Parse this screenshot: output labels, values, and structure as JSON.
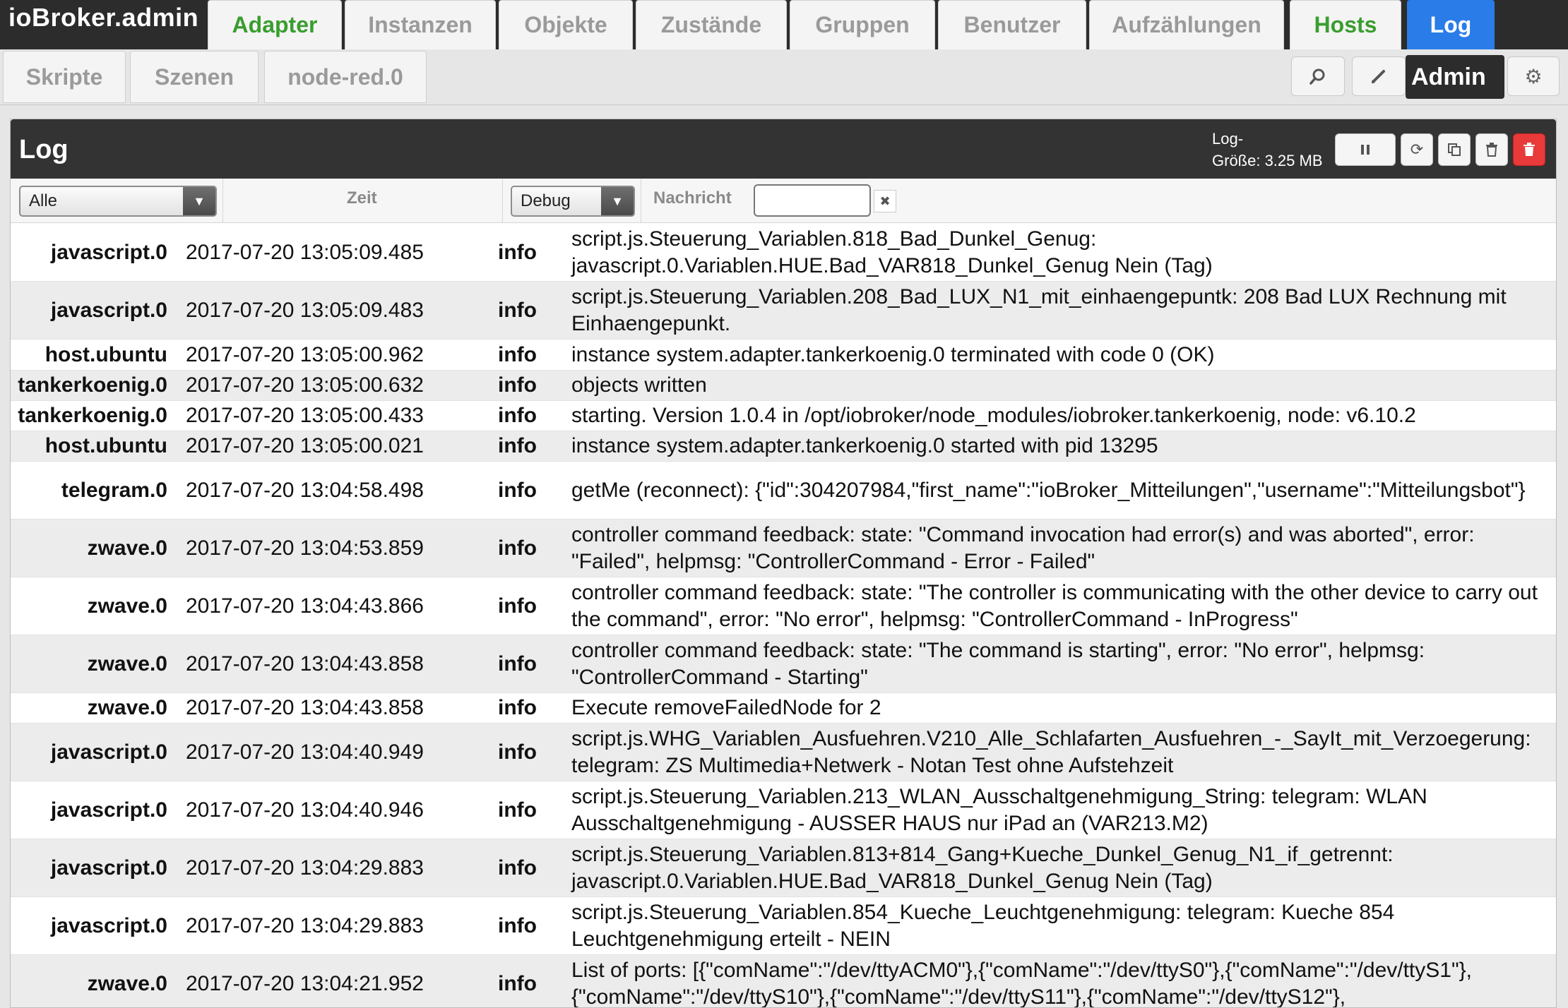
{
  "app": {
    "brand": "ioBroker.admin"
  },
  "tabs": [
    {
      "label": "Adapter"
    },
    {
      "label": "Instanzen"
    },
    {
      "label": "Objekte"
    },
    {
      "label": "Zustände"
    },
    {
      "label": "Gruppen"
    },
    {
      "label": "Benutzer"
    },
    {
      "label": "Aufzählungen"
    },
    {
      "label": "Hosts"
    },
    {
      "label": "Log"
    }
  ],
  "subtabs": [
    {
      "label": "Skripte"
    },
    {
      "label": "Szenen"
    },
    {
      "label": "node-red.0"
    }
  ],
  "user": {
    "name": "Admin"
  },
  "panel": {
    "title": "Log",
    "log_size_label": "Log-",
    "log_size_value": "Größe: 3.25 MB"
  },
  "filters": {
    "source_selected": "Alle",
    "time_header": "Zeit",
    "level_selected": "Debug",
    "message_header": "Nachricht",
    "message_value": ""
  },
  "icons": {
    "search": "search-icon",
    "edit": "pencil-icon",
    "settings": "gear-icon",
    "pause": "pause-icon",
    "refresh": "refresh-icon",
    "copy": "copy-icon",
    "trash": "trash-icon",
    "clear": "close-icon"
  },
  "colors": {
    "accent": "#2a7ce8",
    "green": "#3a9d2f",
    "danger": "#e83a3a"
  },
  "log": [
    {
      "source": "javascript.0",
      "time": "2017-07-20 13:05:09.485",
      "severity": "info",
      "message": "script.js.Steuerung_Variablen.818_Bad_Dunkel_Genug: javascript.0.Variablen.HUE.Bad_VAR818_Dunkel_Genug Nein (Tag)"
    },
    {
      "source": "javascript.0",
      "time": "2017-07-20 13:05:09.483",
      "severity": "info",
      "message": "script.js.Steuerung_Variablen.208_Bad_LUX_N1_mit_einhaengepuntk: 208 Bad LUX Rechnung mit Einhaengepunkt."
    },
    {
      "source": "host.ubuntu",
      "time": "2017-07-20 13:05:00.962",
      "severity": "info",
      "message": "instance system.adapter.tankerkoenig.0 terminated with code 0 (OK)"
    },
    {
      "source": "tankerkoenig.0",
      "time": "2017-07-20 13:05:00.632",
      "severity": "info",
      "message": "objects written"
    },
    {
      "source": "tankerkoenig.0",
      "time": "2017-07-20 13:05:00.433",
      "severity": "info",
      "message": "starting. Version 1.0.4 in /opt/iobroker/node_modules/iobroker.tankerkoenig, node: v6.10.2"
    },
    {
      "source": "host.ubuntu",
      "time": "2017-07-20 13:05:00.021",
      "severity": "info",
      "message": "instance system.adapter.tankerkoenig.0 started with pid 13295"
    },
    {
      "source": "telegram.0",
      "time": "2017-07-20 13:04:58.498",
      "severity": "info",
      "message": "getMe (reconnect): {\"id\":304207984,\"first_name\":\"ioBroker_Mitteilungen\",\"username\":\"Mitteilungsbot\"}"
    },
    {
      "source": "zwave.0",
      "time": "2017-07-20 13:04:53.859",
      "severity": "info",
      "message": "controller command feedback: state: \"Command invocation had error(s) and was aborted\", error: \"Failed\", helpmsg: \"ControllerCommand - Error - Failed\""
    },
    {
      "source": "zwave.0",
      "time": "2017-07-20 13:04:43.866",
      "severity": "info",
      "message": "controller command feedback: state: \"The controller is communicating with the other device to carry out the command\", error: \"No error\", helpmsg: \"ControllerCommand - InProgress\""
    },
    {
      "source": "zwave.0",
      "time": "2017-07-20 13:04:43.858",
      "severity": "info",
      "message": "controller command feedback: state: \"The command is starting\", error: \"No error\", helpmsg: \"ControllerCommand - Starting\""
    },
    {
      "source": "zwave.0",
      "time": "2017-07-20 13:04:43.858",
      "severity": "info",
      "message": "Execute removeFailedNode for 2"
    },
    {
      "source": "javascript.0",
      "time": "2017-07-20 13:04:40.949",
      "severity": "info",
      "message": "script.js.WHG_Variablen_Ausfuehren.V210_Alle_Schlafarten_Ausfuehren_-_SayIt_mit_Verzoegerung: telegram: ZS Multimedia+Netwerk - Notan Test ohne Aufstehzeit"
    },
    {
      "source": "javascript.0",
      "time": "2017-07-20 13:04:40.946",
      "severity": "info",
      "message": "script.js.Steuerung_Variablen.213_WLAN_Ausschaltgenehmigung_String: telegram: WLAN Ausschaltgenehmigung - AUSSER HAUS nur iPad an (VAR213.M2)"
    },
    {
      "source": "javascript.0",
      "time": "2017-07-20 13:04:29.883",
      "severity": "info",
      "message": "script.js.Steuerung_Variablen.813+814_Gang+Kueche_Dunkel_Genug_N1_if_getrennt: javascript.0.Variablen.HUE.Bad_VAR818_Dunkel_Genug Nein (Tag)"
    },
    {
      "source": "javascript.0",
      "time": "2017-07-20 13:04:29.883",
      "severity": "info",
      "message": "script.js.Steuerung_Variablen.854_Kueche_Leuchtgenehmigung: telegram: Kueche 854 Leuchtgenehmigung erteilt - NEIN"
    },
    {
      "source": "zwave.0",
      "time": "2017-07-20 13:04:21.952",
      "severity": "info",
      "message": "List of ports: [{\"comName\":\"/dev/ttyACM0\"},{\"comName\":\"/dev/ttyS0\"},{\"comName\":\"/dev/ttyS1\"},{\"comName\":\"/dev/ttyS10\"},{\"comName\":\"/dev/ttyS11\"},{\"comName\":\"/dev/ttyS12\"},"
    }
  ]
}
